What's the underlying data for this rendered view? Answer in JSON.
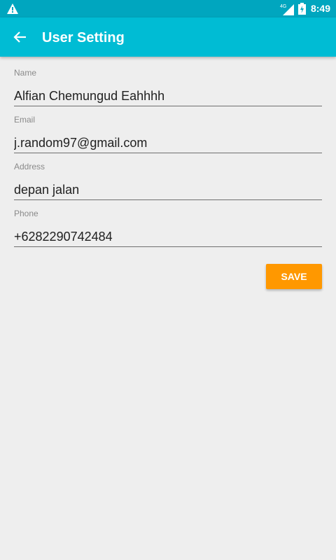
{
  "status_bar": {
    "time": "8:49",
    "network_label": "4G",
    "icons": [
      "warning-icon",
      "signal-icon",
      "battery-charging-icon"
    ]
  },
  "app_bar": {
    "title": "User Setting",
    "back_icon": "arrow-left-icon"
  },
  "form": {
    "fields": [
      {
        "label": "Name",
        "value": "Alfian Chemungud Eahhhh"
      },
      {
        "label": "Email",
        "value": "j.random97@gmail.com"
      },
      {
        "label": "Address",
        "value": "depan jalan"
      },
      {
        "label": "Phone",
        "value": "+6282290742484"
      }
    ],
    "save_label": "SAVE"
  },
  "colors": {
    "app_bar": "#00bcd4",
    "status_bar": "#00a6bf",
    "accent": "#ff9800",
    "background": "#eeeeee"
  }
}
